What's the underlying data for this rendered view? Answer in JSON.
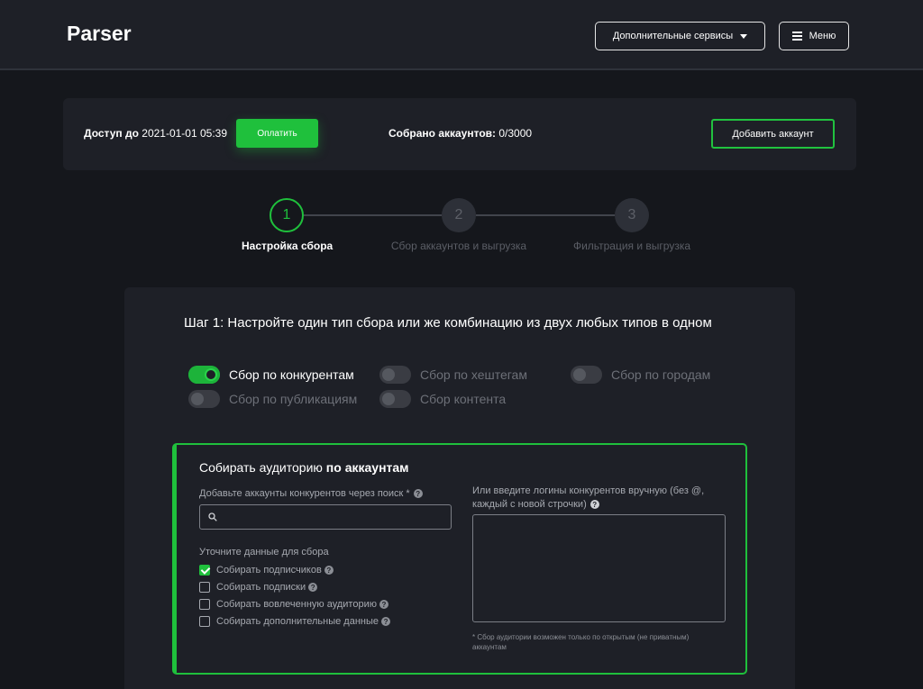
{
  "header": {
    "logo": "Parser",
    "services_label": "Дополнительные сервисы",
    "menu_label": "Меню"
  },
  "access": {
    "label": "Доступ до",
    "date": "2021-01-01 05:39",
    "pay_label": "Оплатить",
    "collected_label": "Собрано аккаунтов:",
    "collected_value": "0/3000",
    "add_account_label": "Добавить аккаунт"
  },
  "steps": [
    {
      "number": "1",
      "label": "Настройка сбора",
      "active": true
    },
    {
      "number": "2",
      "label": "Сбор аккаунтов и выгрузка",
      "active": false
    },
    {
      "number": "3",
      "label": "Фильтрация и выгрузка",
      "active": false
    }
  ],
  "main": {
    "title": "Шаг 1: Настройте один тип сбора или же комбинацию из двух любых типов в одном",
    "toggles": [
      {
        "label": "Сбор по конкурентам",
        "on": true
      },
      {
        "label": "Сбор по хештегам",
        "on": false
      },
      {
        "label": "Сбор по городам",
        "on": false
      },
      {
        "label": "Сбор по публикациям",
        "on": false
      },
      {
        "label": "Сбор контента",
        "on": false
      }
    ]
  },
  "config": {
    "title_prefix": "Собирать аудиторию",
    "title_bold": "по аккаунтам",
    "search_label": "Добавьте аккаунты конкурентов через поиск *",
    "search_value": "",
    "refine_label": "Уточните данные для сбора",
    "options": [
      {
        "label": "Собирать подписчиков",
        "checked": true
      },
      {
        "label": "Собирать подписки",
        "checked": false
      },
      {
        "label": "Собирать вовлеченную аудиторию",
        "checked": false
      },
      {
        "label": "Собирать дополнительные данные",
        "checked": false
      }
    ],
    "manual_label_line1": "Или введите логины конкурентов вручную (без @,",
    "manual_label_line2": "каждый с новой строчки)",
    "manual_value": "",
    "footnote": "* Сбор аудитории возможен только по открытым (не приватным) аккаунтам"
  },
  "colors": {
    "accent": "#1fc03c",
    "background": "#15171c",
    "panel": "#1e2027"
  }
}
